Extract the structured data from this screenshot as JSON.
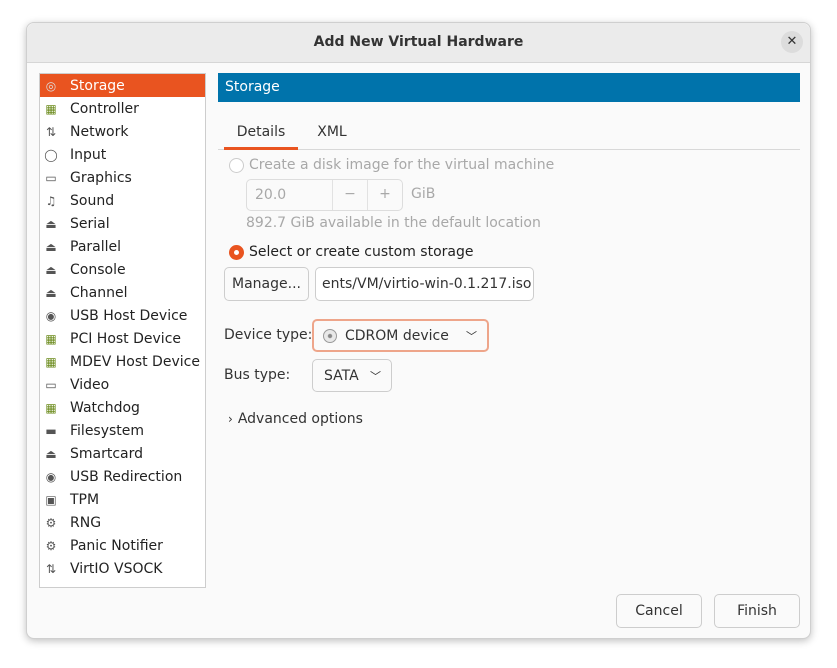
{
  "window": {
    "title": "Add New Virtual Hardware",
    "close_icon": "close-icon"
  },
  "sidebar": {
    "items": [
      {
        "label": "Storage",
        "icon": "disk-icon"
      },
      {
        "label": "Controller",
        "icon": "card-icon"
      },
      {
        "label": "Network",
        "icon": "network-icon"
      },
      {
        "label": "Input",
        "icon": "mouse-icon"
      },
      {
        "label": "Graphics",
        "icon": "monitor-icon"
      },
      {
        "label": "Sound",
        "icon": "music-icon"
      },
      {
        "label": "Serial",
        "icon": "port-icon"
      },
      {
        "label": "Parallel",
        "icon": "port-icon"
      },
      {
        "label": "Console",
        "icon": "port-icon"
      },
      {
        "label": "Channel",
        "icon": "port-icon"
      },
      {
        "label": "USB Host Device",
        "icon": "usb-icon"
      },
      {
        "label": "PCI Host Device",
        "icon": "card-icon"
      },
      {
        "label": "MDEV Host Device",
        "icon": "card-icon"
      },
      {
        "label": "Video",
        "icon": "monitor-icon"
      },
      {
        "label": "Watchdog",
        "icon": "card-icon"
      },
      {
        "label": "Filesystem",
        "icon": "folder-icon"
      },
      {
        "label": "Smartcard",
        "icon": "port-icon"
      },
      {
        "label": "USB Redirection",
        "icon": "usb-icon"
      },
      {
        "label": "TPM",
        "icon": "chip-icon"
      },
      {
        "label": "RNG",
        "icon": "gears-icon"
      },
      {
        "label": "Panic Notifier",
        "icon": "gears-icon"
      },
      {
        "label": "VirtIO VSOCK",
        "icon": "network-icon"
      }
    ],
    "selected": "Storage"
  },
  "panel": {
    "header": "Storage",
    "tabs": [
      {
        "label": "Details",
        "active": true
      },
      {
        "label": "XML",
        "active": false
      }
    ],
    "create_disk_label": "Create a disk image for the virtual machine",
    "disk_size": "20.0",
    "minus": "−",
    "plus": "+",
    "unit": "GiB",
    "available": "892.7 GiB available in the default location",
    "custom_label": "Select or create custom storage",
    "manage_label": "Manage...",
    "path": "ents/VM/virtio-win-0.1.217.iso",
    "device_type_label": "Device type:",
    "device_type": "CDROM device",
    "bus_type_label": "Bus type:",
    "bus_type": "SATA",
    "advanced": "Advanced options"
  },
  "footer": {
    "cancel": "Cancel",
    "finish": "Finish"
  },
  "colors": {
    "accent": "#e95420",
    "header": "#0073ab"
  }
}
